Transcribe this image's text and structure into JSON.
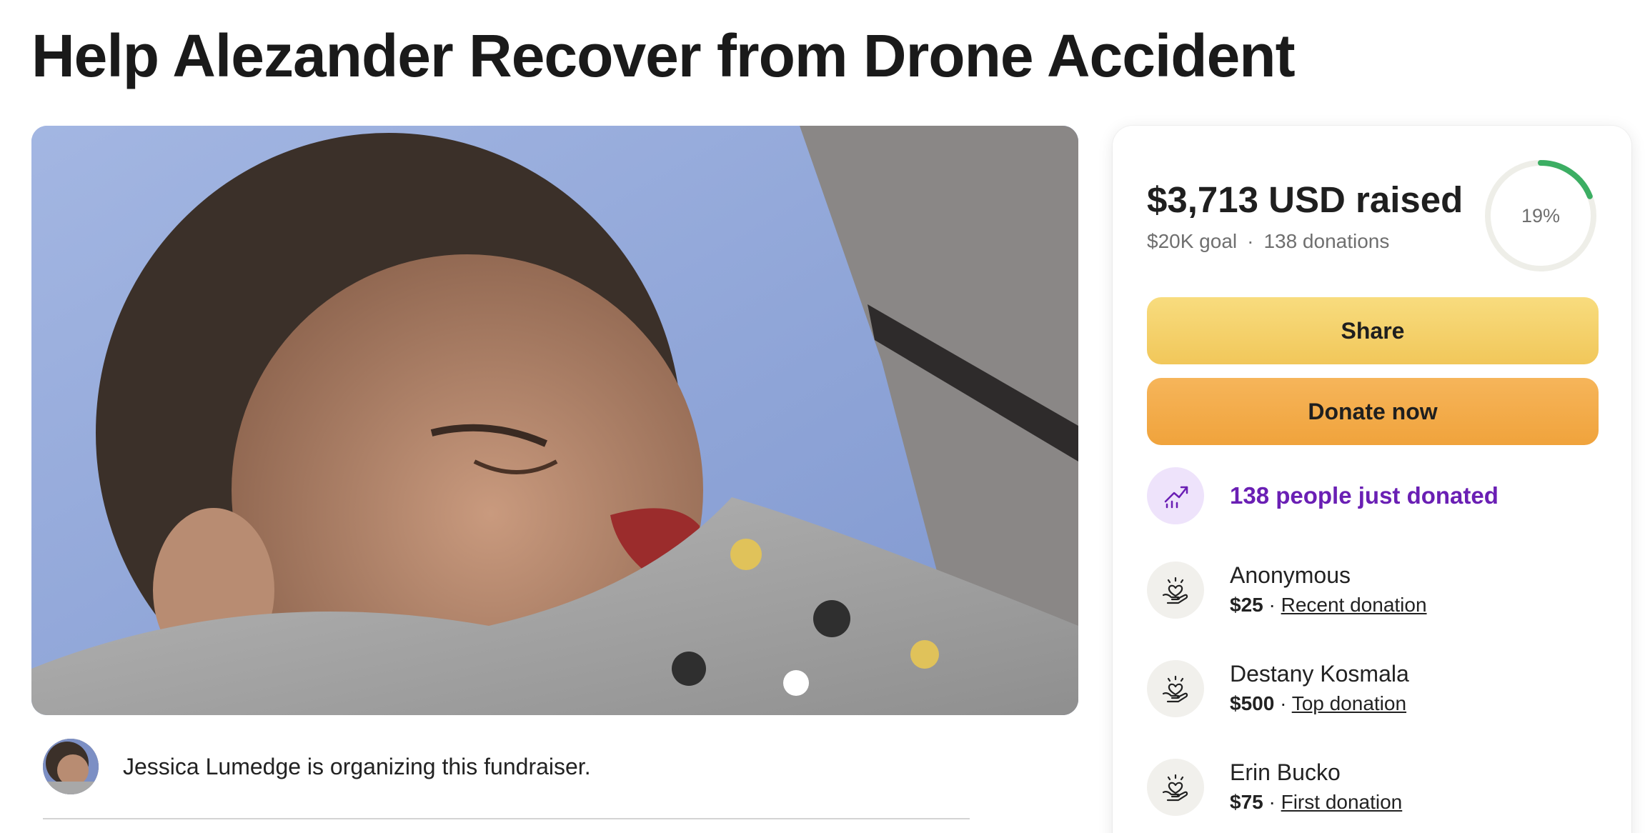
{
  "page": {
    "title": "Help Alezander Recover from Drone Accident"
  },
  "organizer": {
    "text": "Jessica Lumedge is organizing this fundraiser."
  },
  "card": {
    "raised": "$3,713 USD raised",
    "goal": "$20K goal",
    "separator": "·",
    "donations_count": "138 donations",
    "progress_label": "19%",
    "progress_fraction": 0.19,
    "share_label": "Share",
    "donate_label": "Donate now",
    "just_donated": "138 people just donated",
    "donors": [
      {
        "name": "Anonymous",
        "amount": "$25",
        "sep": " · ",
        "tag": "Recent donation"
      },
      {
        "name": "Destany Kosmala",
        "amount": "$500",
        "sep": " · ",
        "tag": "Top donation"
      },
      {
        "name": "Erin Bucko",
        "amount": "$75",
        "sep": " · ",
        "tag": "First donation"
      }
    ]
  },
  "colors": {
    "progress_track": "#eeeee8",
    "progress_fill": "#3cae63",
    "share_button": "#f4d06a",
    "donate_button": "#f2a943",
    "accent_purple": "#6a1fb4"
  },
  "icons": {
    "trend": "trending-up-icon",
    "donor": "heart-hand-icon"
  }
}
